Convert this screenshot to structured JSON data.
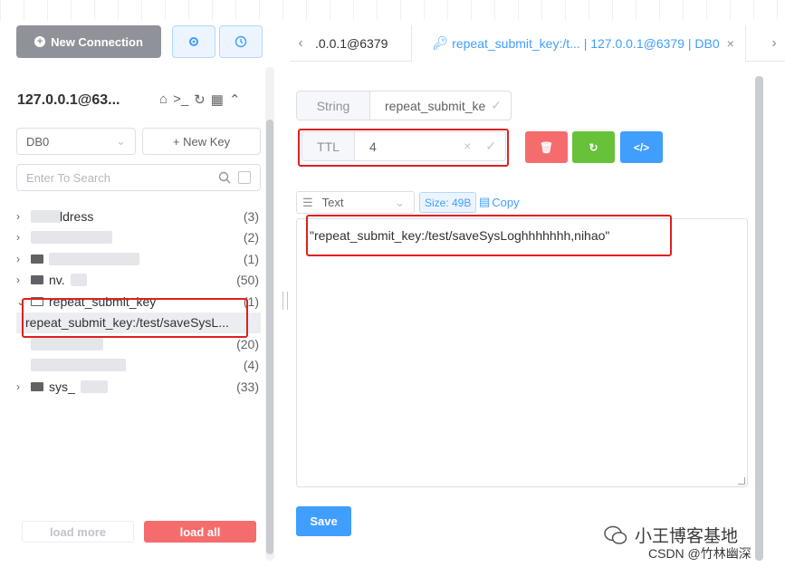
{
  "toolbar": {
    "new_connection_label": "New Connection"
  },
  "connection": {
    "title": "127.0.0.1@63...",
    "db_selected": "DB0",
    "new_key_label": "+ New Key",
    "search_placeholder": "Enter To Search"
  },
  "tree": {
    "rows": [
      {
        "label": "ldress",
        "count": "(3)"
      },
      {
        "label": "",
        "count": "(2)"
      },
      {
        "label": "",
        "count": "(1)"
      },
      {
        "label": "nv.",
        "count": "(50)"
      },
      {
        "label": "repeat_submit_key",
        "count": "(1)"
      },
      {
        "label": "repeat_submit_key:/test/saveSysL...",
        "count": ""
      },
      {
        "label": "",
        "count": "(20)"
      },
      {
        "label": "",
        "count": "(4)"
      },
      {
        "label": "sys_",
        "count": "(33)"
      }
    ]
  },
  "footer": {
    "load_more": "load more",
    "load_all": "load all"
  },
  "tabs": {
    "items": [
      {
        "label": ".0.0.1@6379"
      },
      {
        "label": "repeat_submit_key:/t... | 127.0.0.1@6379 | DB0"
      }
    ]
  },
  "editor": {
    "type_label": "String",
    "key_value": "repeat_submit_ke",
    "ttl_label": "TTL",
    "ttl_value": "4",
    "format_label": "Text",
    "size_label": "Size: 49B",
    "copy_label": "Copy",
    "value_text": "\"repeat_submit_key:/test/saveSysLoghhhhhhh,nihao\"",
    "save_label": "Save"
  },
  "watermark": {
    "line1": "小王博客基地",
    "line2": "CSDN @竹林幽深"
  },
  "colors": {
    "primary": "#409eff",
    "danger": "#f56c6c",
    "success": "#67c23a",
    "highlight_box": "#e02020",
    "neutral_button": "#8f9399"
  }
}
